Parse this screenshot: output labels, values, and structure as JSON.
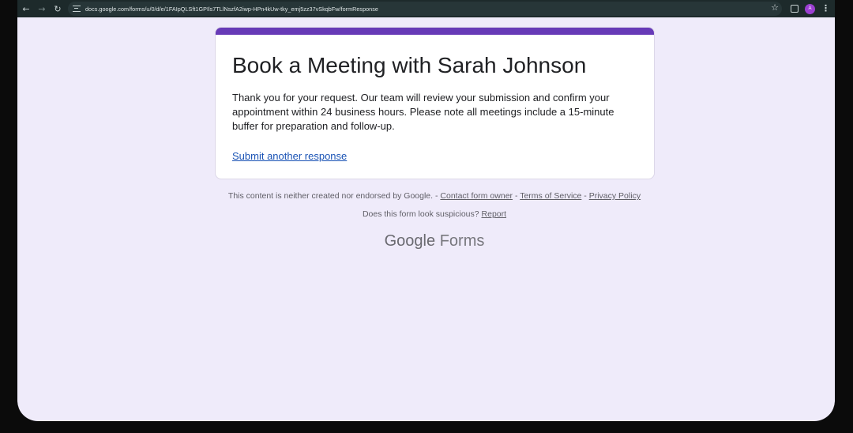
{
  "browser": {
    "url": "docs.google.com/forms/u/0/d/e/1FAIpQLSft1GPIls7TLlNszfA2iwp-HPn4kUw-tky_emj5zz37vSkqbFw/formResponse",
    "avatar_letter": "A"
  },
  "form": {
    "title": "Book a Meeting with Sarah Johnson",
    "message": "Thank you for your request. Our team will review your submission and confirm your appointment within 24 business hours. Please note all meetings include a 15-minute buffer for preparation and follow-up.",
    "another_response_link": "Submit another response",
    "accent_color": "#673ab7"
  },
  "footer": {
    "disclaimer": "This content is neither created nor endorsed by Google. -",
    "contact_link": "Contact form owner",
    "sep1": "-",
    "terms_link": "Terms of Service",
    "sep2": "-",
    "privacy_link": "Privacy Policy",
    "suspicious_text": "Does this form look suspicious?",
    "report_link": "Report"
  },
  "brand": {
    "google": "Google",
    "forms": "Forms"
  }
}
